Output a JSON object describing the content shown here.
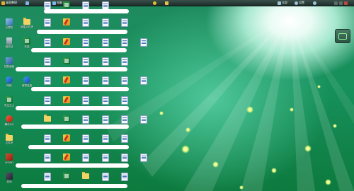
{
  "topbar": {
    "items": [
      {
        "label": "桌面整理",
        "icon": "app-menu-icon",
        "color": "#e0b030"
      },
      {
        "label": "",
        "icon": "monitor-icon",
        "color": "#7fb6e8"
      },
      {
        "label": "电脑",
        "icon": "computer-icon",
        "color": "#7fb6e8"
      },
      {
        "label": "",
        "icon": "shield-icon",
        "color": "#e0c030"
      },
      {
        "label": "",
        "icon": "folder-icon",
        "color": "#e8c050"
      }
    ],
    "right": [
      {
        "label": "全部",
        "icon": "settings-icon"
      },
      {
        "label": "设置",
        "icon": "gear-icon"
      },
      {
        "label": "",
        "icon": "help-icon"
      }
    ]
  },
  "desktop": {
    "left_column": [
      {
        "label": "计算机",
        "icon": "computer-icon"
      },
      {
        "label": "回收站",
        "icon": "trash-icon"
      },
      {
        "label": "控制面板",
        "icon": "control-panel-icon"
      },
      {
        "label": "网络",
        "icon": "network-icon"
      },
      {
        "label": "安全卫士",
        "icon": "shield-app-icon"
      },
      {
        "label": "浏览器",
        "icon": "browser-icon"
      },
      {
        "label": "腾讯QQ",
        "icon": "qq-icon"
      },
      {
        "label": "文件夹",
        "icon": "folder-icon"
      },
      {
        "label": "WORD",
        "icon": "word-icon"
      },
      {
        "label": "游戏",
        "icon": "game-icon"
      }
    ],
    "second_column": [
      {
        "label": "新建文件夹",
        "icon": "folder-icon"
      },
      {
        "label": "安装",
        "icon": "package-icon"
      },
      {
        "label": "宽带连接",
        "icon": "network-connection-icon"
      },
      {
        "label": "SKYPE",
        "icon": "skype-icon"
      }
    ],
    "grid_labels": [
      "文档",
      "压缩包",
      "快捷方式",
      "文本",
      "图片",
      "程序"
    ]
  }
}
